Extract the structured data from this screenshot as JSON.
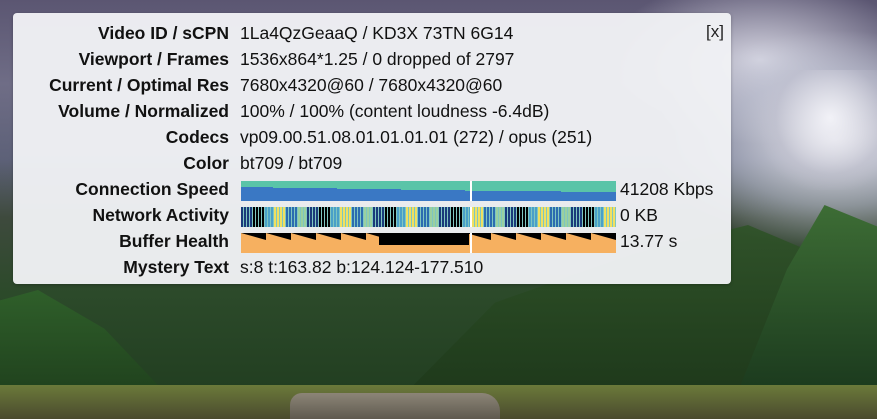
{
  "panel": {
    "close_label": "[x]",
    "rows": [
      {
        "label": "Video ID / sCPN",
        "value": "1La4QzGeaaQ / KD3X 73TN 6G14"
      },
      {
        "label": "Viewport / Frames",
        "value": "1536x864*1.25 / 0 dropped of 2797"
      },
      {
        "label": "Current / Optimal Res",
        "value": "7680x4320@60 / 7680x4320@60"
      },
      {
        "label": "Volume / Normalized",
        "value": "100% / 100% (content loudness -6.4dB)"
      },
      {
        "label": "Codecs",
        "value": "vp09.00.51.08.01.01.01.01 (272) / opus (251)"
      },
      {
        "label": "Color",
        "value": "bt709 / bt709"
      }
    ],
    "graphs": {
      "connection_speed": {
        "label": "Connection Speed",
        "value": "41208 Kbps"
      },
      "network_activity": {
        "label": "Network Activity",
        "value": "0 KB"
      },
      "buffer_health": {
        "label": "Buffer Health",
        "value": "13.77 s"
      }
    },
    "mystery": {
      "label": "Mystery Text",
      "value": "s:8 t:163.82 b:124.124-177.510"
    }
  },
  "colors": {
    "speed_fill": "#5ac4a8",
    "speed_bar": "#3a78c4",
    "buffer_fill": "#f6b060",
    "graph_bg": "#000000"
  }
}
